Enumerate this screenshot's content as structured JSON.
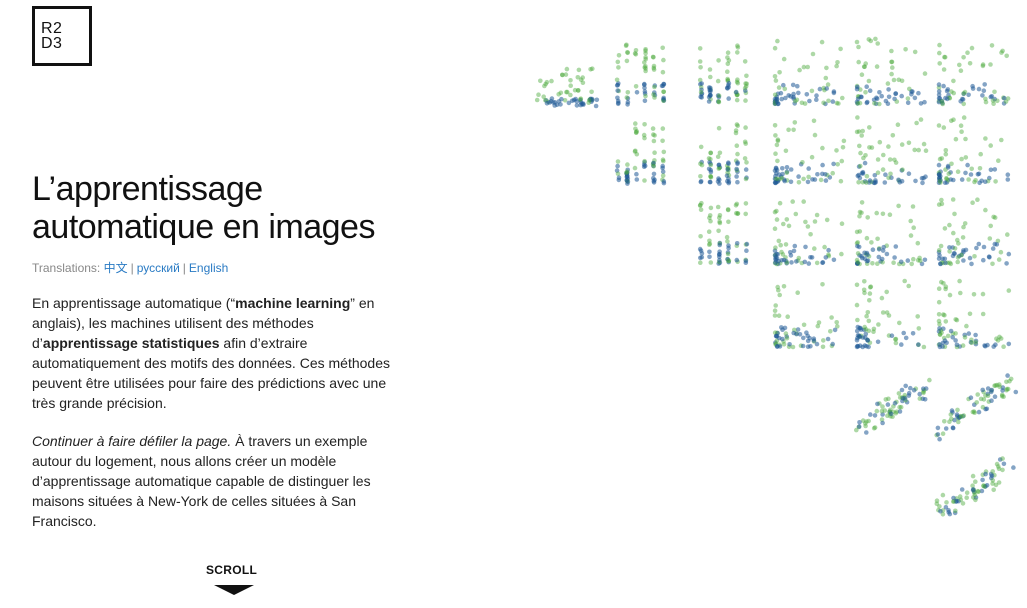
{
  "logo": {
    "line1": "R2",
    "line2": "D3"
  },
  "title": "L’apprentissage automatique en images",
  "translations": {
    "label": "Translations:",
    "links": [
      "中文",
      "русский",
      "English"
    ]
  },
  "intro": {
    "p1_a": "En apprentissage automatique (“",
    "p1_b": "machine learning",
    "p1_c": "” en anglais), les machines utilisent des méthodes d’",
    "p1_d": "apprentissage statistiques",
    "p1_e": " afin d’extraire automatiquement des motifs des données. Ces méthodes peuvent être utilisées pour faire des prédictions avec une très grande précision.",
    "p2_a": "Continuer à faire défiler la page.",
    "p2_b": " À travers un exemple autour du logement, nous allons créer un modèle d’apprentissage automatique capable de distinguer les maisons situées à New-York de celles situées à San Francisco."
  },
  "scroll_label": "SCROLL",
  "colors": {
    "new_york": "#1f5a96",
    "san_francisco": "#4aa83a",
    "link": "#2a7bc4"
  }
}
